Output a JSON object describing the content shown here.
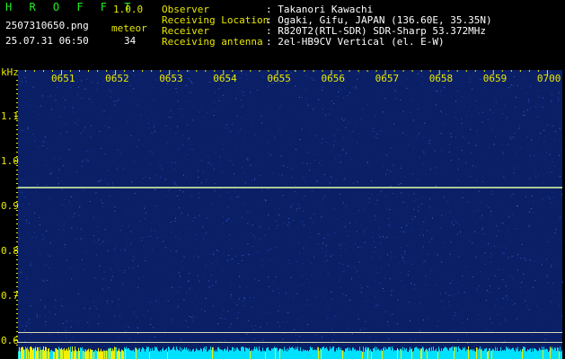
{
  "header": {
    "app_name": "H R O F F T",
    "version": "1.0.0",
    "filename": "2507310650.png",
    "datetime": "25.07.31 06:50",
    "meteor_label": "meteor",
    "meteor_count": "34",
    "fields": [
      {
        "label": "Observer",
        "value": ": Takanori Kawachi"
      },
      {
        "label": "Receiving Location",
        "value": ": Ogaki, Gifu, JAPAN (136.60E, 35.35N)"
      },
      {
        "label": "Receiver",
        "value": ": R820T2(RTL-SDR) SDR-Sharp 53.372MHz"
      },
      {
        "label": "Receiving antenna",
        "value": ": 2el-HB9CV Vertical (el. E-W)"
      }
    ]
  },
  "chart_data": {
    "type": "heatmap",
    "ylabel": "kHz",
    "x_ticks": [
      "0651",
      "0652",
      "0653",
      "0654",
      "0655",
      "0656",
      "0657",
      "0658",
      "0659",
      "0700"
    ],
    "y_ticks": [
      "1.1",
      "1.0",
      "0.9",
      "0.8",
      "0.7",
      "0.6"
    ],
    "ylim": [
      0.58,
      1.19
    ],
    "carrier_khz": 0.94,
    "colors": {
      "background": "#0a1f66",
      "carrier": "#c8e8a0",
      "tick": "#e8e800",
      "bottom_bars": "#00e0ff",
      "bottom_bars_hot": "#f0f000"
    }
  }
}
